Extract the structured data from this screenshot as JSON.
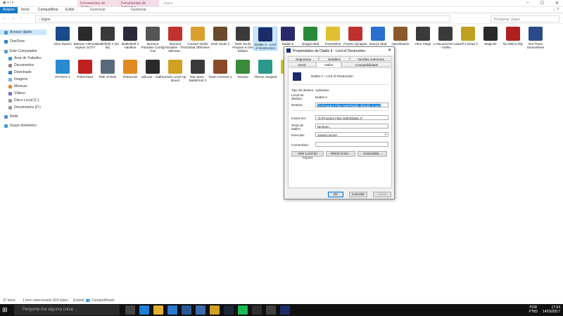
{
  "window": {
    "title": "Jogos",
    "context_tab_1": "Ferramentas de Atalho",
    "context_tab_2": "Ferramentas de Aplicativo",
    "tabs": [
      "Arquivo",
      "Início",
      "Compartilhar",
      "Exibir",
      "Gerenciar",
      "Gerenciar"
    ],
    "path": "› Jogos",
    "search_placeholder": "Pesquisar Jogos"
  },
  "sidebar": {
    "items": [
      {
        "label": "Acesso rápido",
        "color": "#4a90d9"
      },
      {
        "label": "OneDrive",
        "color": "#2f7fd8"
      },
      {
        "label": "Este Computador",
        "color": "#5a9bd5"
      },
      {
        "label": "Área de Trabalho",
        "color": "#3a8fd5"
      },
      {
        "label": "Documentos",
        "color": "#8a8a8a"
      },
      {
        "label": "Downloads",
        "color": "#2f7fd8"
      },
      {
        "label": "Imagens",
        "color": "#7ab0e0"
      },
      {
        "label": "Músicas",
        "color": "#e08a3a"
      },
      {
        "label": "Vídeos",
        "color": "#7a6ad0"
      },
      {
        "label": "Disco Local (C:)",
        "color": "#999999"
      },
      {
        "label": "Documentos (D:)",
        "color": "#999999"
      },
      {
        "label": "Rede",
        "color": "#4a90d9"
      },
      {
        "label": "Grupo doméstico",
        "color": "#3aa0d0"
      }
    ]
  },
  "icons": [
    {
      "label": "Alien Swarm",
      "color": "#1a4a8a"
    },
    {
      "label": "Batman Arkham Asylum GOTY",
      "color": "#2a2a2a"
    },
    {
      "label": "Battlefield 4 (64 bit)",
      "color": "#3a3a3a"
    },
    {
      "label": "Battlefield 4 Hardline",
      "color": "#2a2a3a"
    },
    {
      "label": "Burnout Paradise Config Tool",
      "color": "#555555"
    },
    {
      "label": "Burnout Paradise - The Ultimate...",
      "color": "#c23030"
    },
    {
      "label": "Counter-Strike Global Offensive",
      "color": "#d9a030"
    },
    {
      "label": "Dark Souls 2",
      "color": "#6a4a2a"
    },
    {
      "label": "Dark Souls Prepare to Die Edition",
      "color": "#3a3a3a"
    },
    {
      "label": "Diablo II - Lord of Destruction",
      "color": "#1c2c6a"
    },
    {
      "label": "Diablo II",
      "color": "#2a2a6a"
    },
    {
      "label": "Dragon Ball Xenoverse",
      "color": "#2a8a3a"
    },
    {
      "label": "FreeOnline Steam",
      "color": "#e0c030"
    },
    {
      "label": "Frozen Synapse",
      "color": "#c03030"
    },
    {
      "label": "Garry's Mod",
      "color": "#2a70d0"
    },
    {
      "label": "Hearthstone",
      "color": "#8a5a2a"
    },
    {
      "label": "Hero Siege",
      "color": "#3a3a3a"
    },
    {
      "label": "LANLauncher.exe - Atalho",
      "color": "#3a3a3a"
    },
    {
      "label": "Left 4 Dead 2",
      "color": "#c0a020"
    },
    {
      "label": "Magicite",
      "color": "#2a2a2a"
    },
    {
      "label": "No Man's Sky",
      "color": "#b02020"
    },
    {
      "label": "Out There Somewhere",
      "color": "#2a4a8a"
    },
    {
      "label": "PAYDAY 2",
      "color": "#2a8ad0"
    },
    {
      "label": "PokerStars",
      "color": "#c02020"
    },
    {
      "label": "Risk of Rain",
      "color": "#5a6a7a"
    },
    {
      "label": "Robocraft",
      "color": "#e08a20"
    },
    {
      "label": "salt.exe - Atalho",
      "color": "#2a2a2a"
    },
    {
      "label": "Smite Level Up Brasil",
      "color": "#d0a020"
    },
    {
      "label": "Star Wars - Battlefront 2",
      "color": "#3a3a3a"
    },
    {
      "label": "Team Fortress 2",
      "color": "#8a4a2a"
    },
    {
      "label": "Terraria",
      "color": "#3a8a3a"
    },
    {
      "label": "Theme Hospital",
      "color": "#2a9a8a"
    },
    {
      "label": "Tor",
      "color": "#d0c020"
    }
  ],
  "status": {
    "count": "37 itens",
    "selection": "1 item selecionado 924 bytes",
    "state": "Estado: 👥 Compartilhado"
  },
  "dialog": {
    "title": "Propriedades de Diablo II - Lord of Destruction",
    "close": "✕",
    "tabs_row1": [
      "Segurança",
      "Detalhes",
      "Versões Anteriores"
    ],
    "tabs_row2": [
      "Geral",
      "Atalho",
      "Compatibilidade"
    ],
    "app_name": "Diablo II - Lord of Destruction",
    "target_type_label": "Tipo de destino:",
    "target_type": "Aplicativo",
    "target_location_label": "Local de destino:",
    "target_location": "Diablo II",
    "target_label": "Destino:",
    "target": "\"D:\\Program Files (x86)\\Diablo II\\Diablo II.exe\"",
    "start_in_label": "Iniciar em:",
    "start_in": "\"D:\\Program Files (x86)\\Diablo II\"",
    "shortcut_key_label": "Tecla de atalho:",
    "shortcut_key": "Nenhum",
    "run_label": "Executar:",
    "run": "Janela normal",
    "comment_label": "Comentário:",
    "comment": "",
    "btn_open_location": "Abrir Local do Arquivo",
    "btn_change_icon": "Alterar Ícone...",
    "btn_advanced": "Avançadas...",
    "btn_ok": "OK",
    "btn_cancel": "Cancelar",
    "btn_apply": "Aplicar"
  },
  "taskbar": {
    "search": "Pergunte-me alguma coisa",
    "lang": "POR",
    "lang2": "PTB2",
    "time": "17:04",
    "date": "14/03/2017",
    "apps": [
      {
        "name": "task-view",
        "color": "#444444"
      },
      {
        "name": "edge",
        "color": "#1e7fd6"
      },
      {
        "name": "explorer",
        "color": "#e0b030"
      },
      {
        "name": "store",
        "color": "#2a7ad0"
      },
      {
        "name": "word",
        "color": "#2b5797"
      },
      {
        "name": "outlook",
        "color": "#3a6ab0"
      },
      {
        "name": "chrome",
        "color": "#d0a020"
      },
      {
        "name": "steam",
        "color": "#1b2838"
      },
      {
        "name": "spotify",
        "color": "#1db954"
      },
      {
        "name": "app-x",
        "color": "#303030"
      },
      {
        "name": "terminal",
        "color": "#404040"
      },
      {
        "name": "diablo",
        "color": "#1c2c6a"
      }
    ]
  }
}
